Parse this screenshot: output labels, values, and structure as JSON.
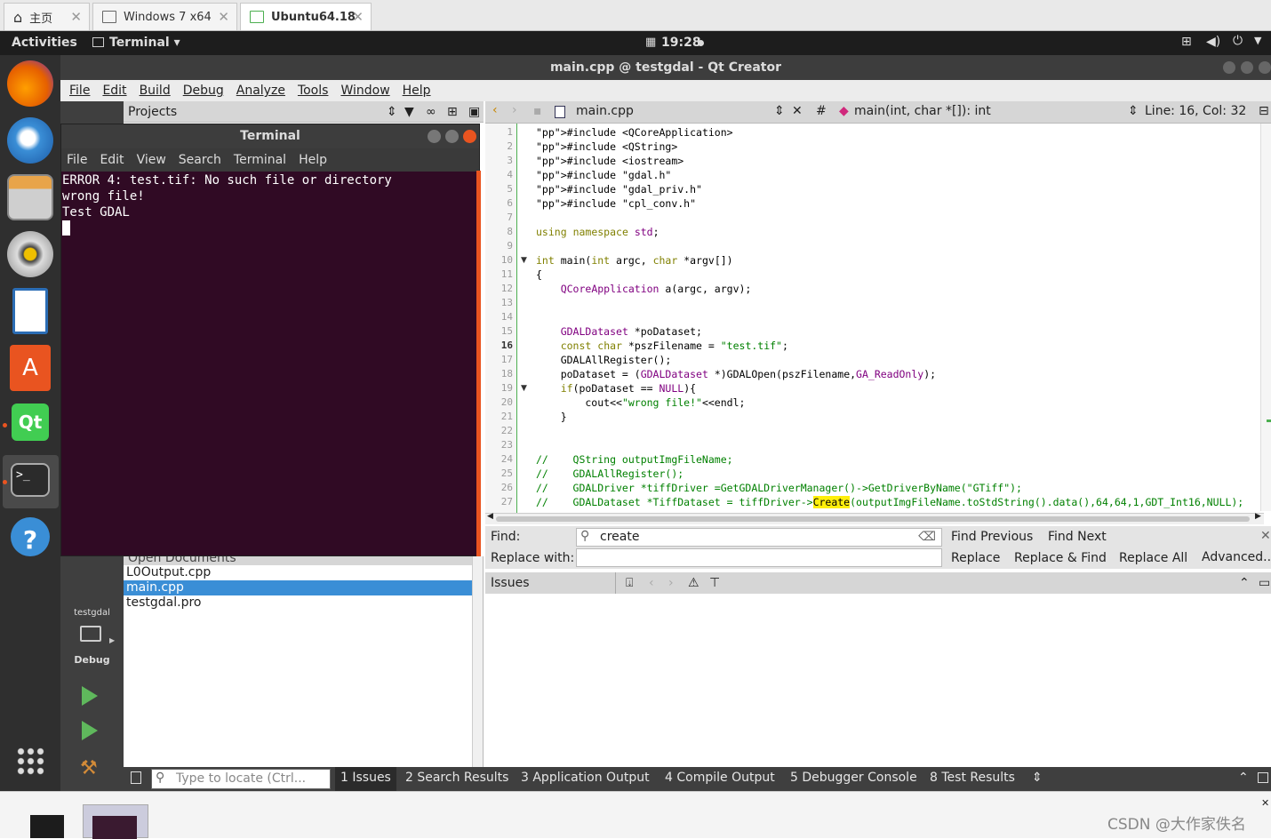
{
  "vm_tabs": [
    {
      "label": "主页"
    },
    {
      "label": "Windows 7 x64"
    },
    {
      "label": "Ubuntu64.18"
    }
  ],
  "topbar": {
    "activities": "Activities",
    "app": "Terminal ▾",
    "clock": "19:28"
  },
  "window": {
    "title": "main.cpp @ testgdal - Qt Creator"
  },
  "menu": [
    "File",
    "Edit",
    "Build",
    "Debug",
    "Analyze",
    "Tools",
    "Window",
    "Help"
  ],
  "projects": {
    "label": "Projects"
  },
  "terminal": {
    "title": "Terminal",
    "menu": [
      "File",
      "Edit",
      "View",
      "Search",
      "Terminal",
      "Help"
    ],
    "lines": [
      "ERROR 4: test.tif: No such file or directory",
      "wrong file!",
      "Test GDAL"
    ]
  },
  "open_documents": {
    "label": "Open Documents",
    "files": [
      "L0Output.cpp",
      "main.cpp",
      "testgdal.pro"
    ]
  },
  "left_panel": {
    "project": "testgdal",
    "mode": "Debug"
  },
  "editor": {
    "file": "main.cpp",
    "symbol": "main(int, char *[]): int",
    "position": "Line: 16, Col: 32",
    "hash": "#"
  },
  "code_lines": [
    "#include <QCoreApplication>",
    "#include <QString>",
    "#include <iostream>",
    "#include \"gdal.h\"",
    "#include \"gdal_priv.h\"",
    "#include \"cpl_conv.h\"",
    "",
    "using namespace std;",
    "",
    "int main(int argc, char *argv[])",
    "{",
    "    QCoreApplication a(argc, argv);",
    "",
    "",
    "    GDALDataset *poDataset;",
    "    const char *pszFilename = \"test.tif\";",
    "    GDALAllRegister();",
    "    poDataset = (GDALDataset *)GDALOpen(pszFilename,GA_ReadOnly);",
    "    if(poDataset == NULL){",
    "        cout<<\"wrong file!\"<<endl;",
    "    }",
    "",
    "",
    "//    QString outputImgFileName;",
    "//    GDALAllRegister();",
    "//    GDALDriver *tiffDriver =GetGDALDriverManager()->GetDriverByName(\"GTiff\");",
    "//    GDALDataset *TiffDataset = tiffDriver->Create(outputImgFileName.toStdString().data(),64,64,1,GDT_Int16,NULL);"
  ],
  "find": {
    "find_label": "Find:",
    "find_value": "create",
    "replace_label": "Replace with:",
    "find_previous": "Find Previous",
    "find_next": "Find Next",
    "replace": "Replace",
    "replace_find": "Replace & Find",
    "replace_all": "Replace All",
    "advanced": "Advanced..."
  },
  "issues": {
    "label": "Issues"
  },
  "statusbar": {
    "locate_placeholder": "Type to locate (Ctrl...",
    "tabs": [
      "1  Issues",
      "2  Search Results",
      "3  Application Output",
      "4  Compile Output",
      "5  Debugger Console",
      "8  Test Results"
    ]
  },
  "watermark": "CSDN @大作家佚名"
}
